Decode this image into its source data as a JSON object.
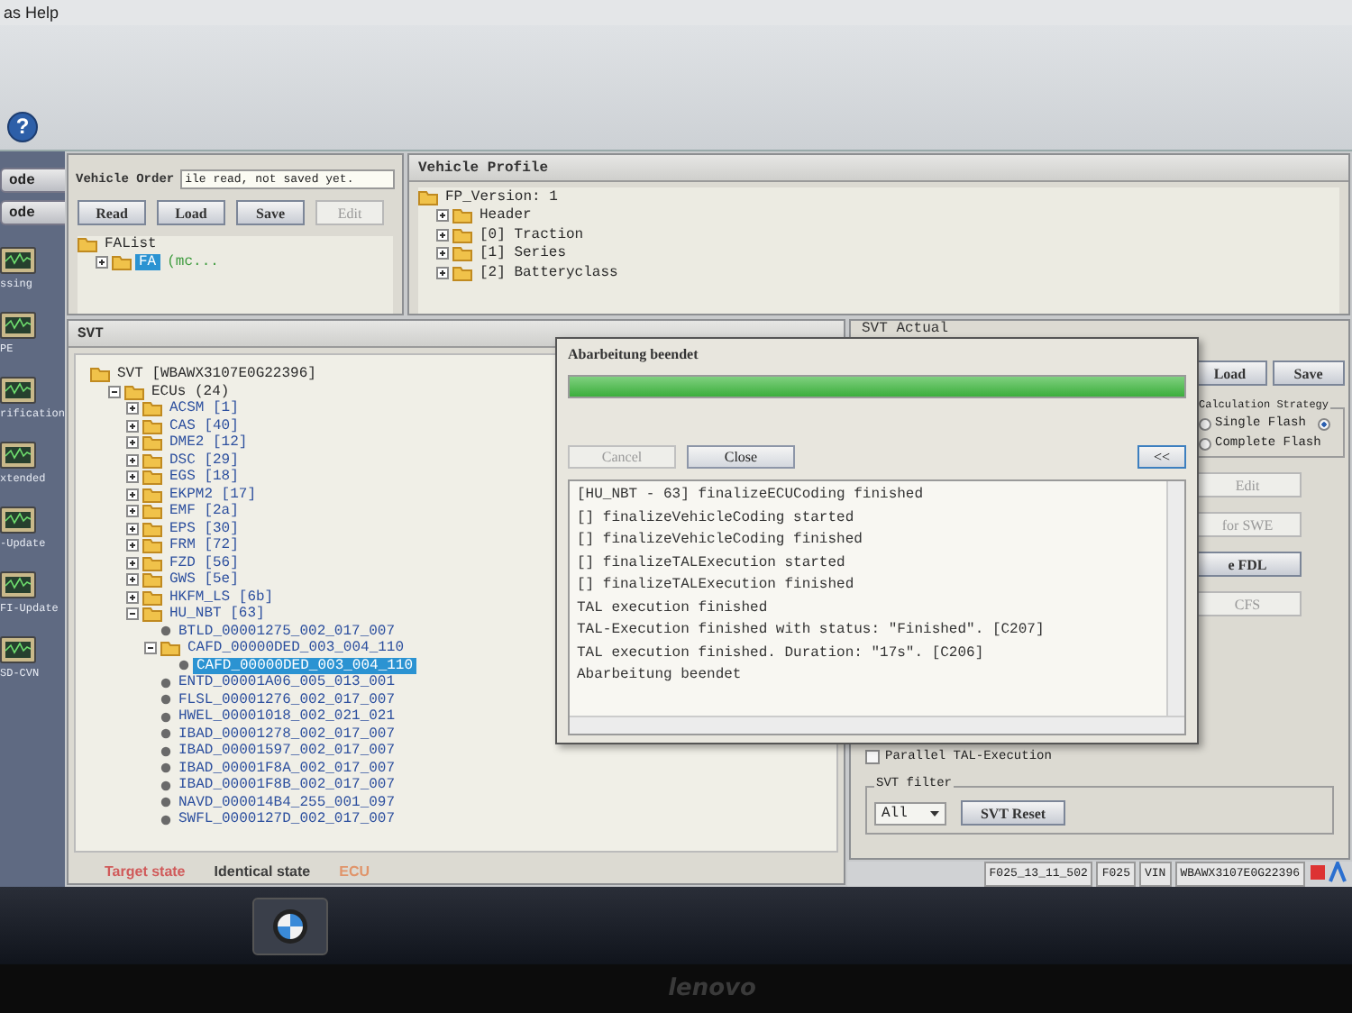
{
  "menu_bar": {
    "text": "as Help"
  },
  "toolbar": {
    "help_button": "?"
  },
  "sidebar": {
    "items": [
      {
        "label": "ode",
        "kind": "button"
      },
      {
        "label": "ode",
        "kind": "button"
      },
      {
        "label": "ssing",
        "kind": "tool"
      },
      {
        "label": "PE",
        "kind": "tool"
      },
      {
        "label": "rification",
        "kind": "tool"
      },
      {
        "label": "xtended",
        "kind": "tool"
      },
      {
        "label": "-Update",
        "kind": "tool"
      },
      {
        "label": "FI-Update",
        "kind": "tool"
      },
      {
        "label": "SD-CVN",
        "kind": "tool"
      }
    ]
  },
  "vehicle_order": {
    "title": "Vehicle Order",
    "status": "ile read, not saved yet.",
    "buttons": [
      {
        "label": "Read",
        "disabled": false
      },
      {
        "label": "Load",
        "disabled": false
      },
      {
        "label": "Save",
        "disabled": false
      },
      {
        "label": "Edit",
        "disabled": true
      }
    ],
    "tree": [
      {
        "label": "FAList",
        "selected": false,
        "children": [
          {
            "label": "FA",
            "note": "(mc...",
            "expanded": false,
            "selected": true
          }
        ]
      }
    ]
  },
  "vehicle_profile": {
    "title": "Vehicle Profile",
    "tree": [
      {
        "label": "FP_Version: 1",
        "selected": false,
        "children": [
          {
            "label": "Header",
            "expanded": false,
            "selected": false
          },
          {
            "label": "[0] Traction",
            "expanded": false,
            "selected": false
          },
          {
            "label": "[1] Series",
            "expanded": false,
            "selected": false
          },
          {
            "label": "[2] Batteryclass",
            "expanded": false,
            "selected": false
          }
        ]
      }
    ]
  },
  "svt": {
    "title": "SVT",
    "tree": [
      {
        "label": "SVT [WBAWX3107E0G22396]",
        "selected": false,
        "children": [
          {
            "label": "ECUs (24)",
            "expanded": true,
            "selected": false,
            "children": [
              {
                "label": "ACSM [1]",
                "expanded": false,
                "selected": false
              },
              {
                "label": "CAS [40]",
                "expanded": false,
                "selected": false
              },
              {
                "label": "DME2 [12]",
                "expanded": false,
                "selected": false
              },
              {
                "label": "DSC [29]",
                "expanded": false,
                "selected": false
              },
              {
                "label": "EGS [18]",
                "expanded": false,
                "selected": false
              },
              {
                "label": "EKPM2 [17]",
                "expanded": false,
                "selected": false
              },
              {
                "label": "EMF [2a]",
                "expanded": false,
                "selected": false
              },
              {
                "label": "EPS [30]",
                "expanded": false,
                "selected": false
              },
              {
                "label": "FRM [72]",
                "expanded": false,
                "selected": false
              },
              {
                "label": "FZD [56]",
                "expanded": false,
                "selected": false
              },
              {
                "label": "GWS [5e]",
                "expanded": false,
                "selected": false
              },
              {
                "label": "HKFM_LS [6b]",
                "expanded": false,
                "selected": false
              },
              {
                "label": "HU_NBT [63]",
                "expanded": true,
                "selected": false,
                "children": [
                  {
                    "label": "BTLD_00001275_002_017_007",
                    "selected": false
                  },
                  {
                    "label": "CAFD_00000DED_003_004_110",
                    "expanded": true,
                    "selected": false,
                    "children": [
                      {
                        "label": "CAFD_00000DED_003_004_110",
                        "selected": true
                      }
                    ]
                  },
                  {
                    "label": "ENTD_00001A06_005_013_001",
                    "selected": false
                  },
                  {
                    "label": "FLSL_00001276_002_017_007",
                    "selected": false
                  },
                  {
                    "label": "HWEL_00001018_002_021_021",
                    "selected": false
                  },
                  {
                    "label": "IBAD_00001278_002_017_007",
                    "selected": false
                  },
                  {
                    "label": "IBAD_00001597_002_017_007",
                    "selected": false
                  },
                  {
                    "label": "IBAD_00001F8A_002_017_007",
                    "selected": false
                  },
                  {
                    "label": "IBAD_00001F8B_002_017_007",
                    "selected": false
                  },
                  {
                    "label": "NAVD_000014B4_255_001_097",
                    "selected": false
                  },
                  {
                    "label": "SWFL_0000127D_002_017_007",
                    "selected": false
                  }
                ]
              }
            ]
          }
        ]
      }
    ],
    "legend": [
      {
        "label": "Target state",
        "color": "#d05a5a"
      },
      {
        "label": "Identical state",
        "color": "#3c3c3c"
      },
      {
        "label": "ECU",
        "color": "#e0946a"
      }
    ]
  },
  "svt_actual": {
    "title": "SVT Actual",
    "buttons": [
      {
        "label": "Load",
        "disabled": false
      },
      {
        "label": "Save",
        "disabled": false
      }
    ],
    "calculation_strategy": {
      "title": "Calculation Strategy",
      "options": [
        {
          "label": "Single Flash",
          "selected": false
        },
        {
          "selected": true
        },
        {
          "label": "Complete Flash",
          "selected": false
        }
      ]
    },
    "actions": [
      {
        "label": "Edit",
        "disabled": true
      },
      {
        "label": "for SWE",
        "disabled": true
      },
      {
        "label": "e FDL",
        "disabled": false
      },
      {
        "label": "CFS",
        "disabled": true
      }
    ],
    "parallel_tal": {
      "label": "Parallel TAL-Execution",
      "checked": false
    },
    "svt_filter": {
      "title": "SVT filter",
      "value": "All",
      "reset": "SVT Reset"
    }
  },
  "status_bar": [
    "F025_13_11_502",
    "F025",
    "VIN",
    "WBAWX3107E0G22396"
  ],
  "dialog": {
    "title": "Abarbeitung beendet",
    "progress": {
      "level": 1
    },
    "buttons": [
      {
        "label": "Cancel",
        "disabled": true
      },
      {
        "label": "Close",
        "disabled": false
      },
      {
        "label": "<<",
        "disabled": false
      }
    ],
    "log": [
      "[HU_NBT - 63] finalizeECUCoding finished",
      "[] finalizeVehicleCoding started",
      "[] finalizeVehicleCoding finished",
      "[] finalizeTALExecution started",
      "[] finalizeTALExecution finished",
      "TAL execution finished",
      "TAL-Execution finished with status: \"Finished\". [C207]",
      "TAL execution finished. Duration: \"17s\". [C206]",
      "Abarbeitung beendet"
    ]
  },
  "taskbar": {
    "brand": "lenovo"
  }
}
